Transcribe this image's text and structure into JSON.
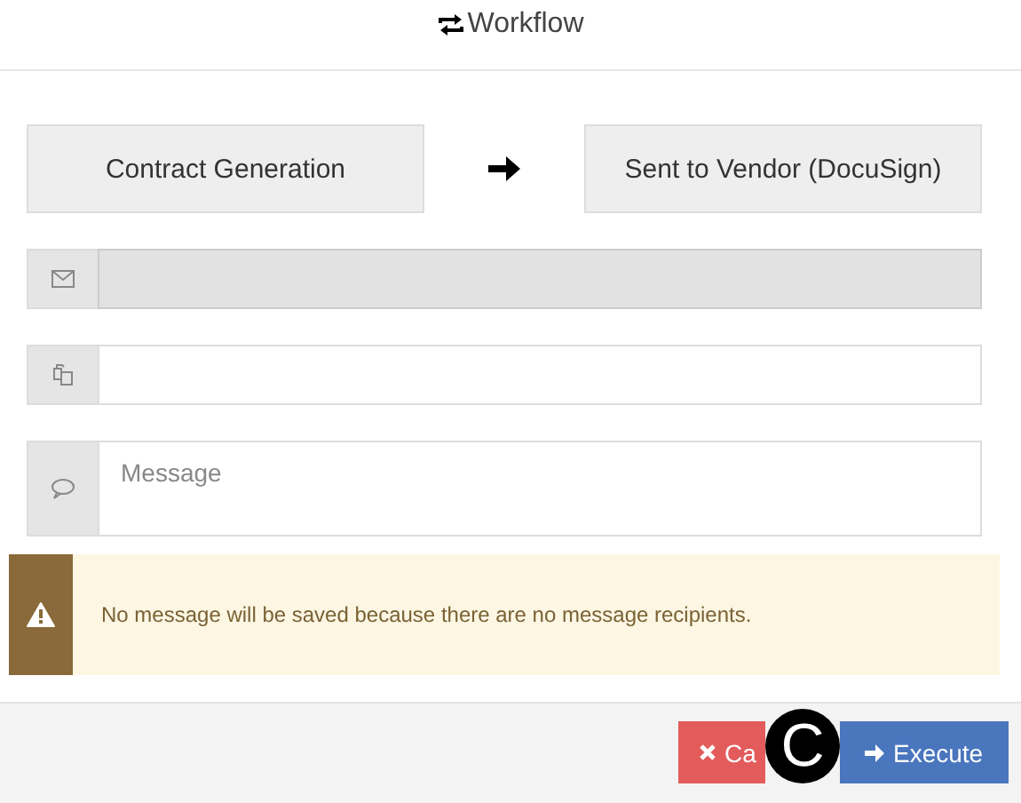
{
  "window": {
    "title": "Workflow"
  },
  "stages": [
    {
      "label": "Contract Generation"
    },
    {
      "label": "Sent to Vendor (DocuSign)"
    }
  ],
  "fields": [
    {
      "kind": "input",
      "disabled": true
    },
    {
      "kind": "input",
      "disabled": false
    },
    {
      "kind": "textarea",
      "disabled": false,
      "placeholder": "Message"
    }
  ],
  "alert": {
    "text": "No message will be saved because there are no message recipients."
  },
  "buttons": [
    {
      "kind": "cancel",
      "label": "Ca"
    },
    {
      "kind": "execute",
      "label": "Execute"
    }
  ],
  "callout": {
    "label": "C"
  }
}
